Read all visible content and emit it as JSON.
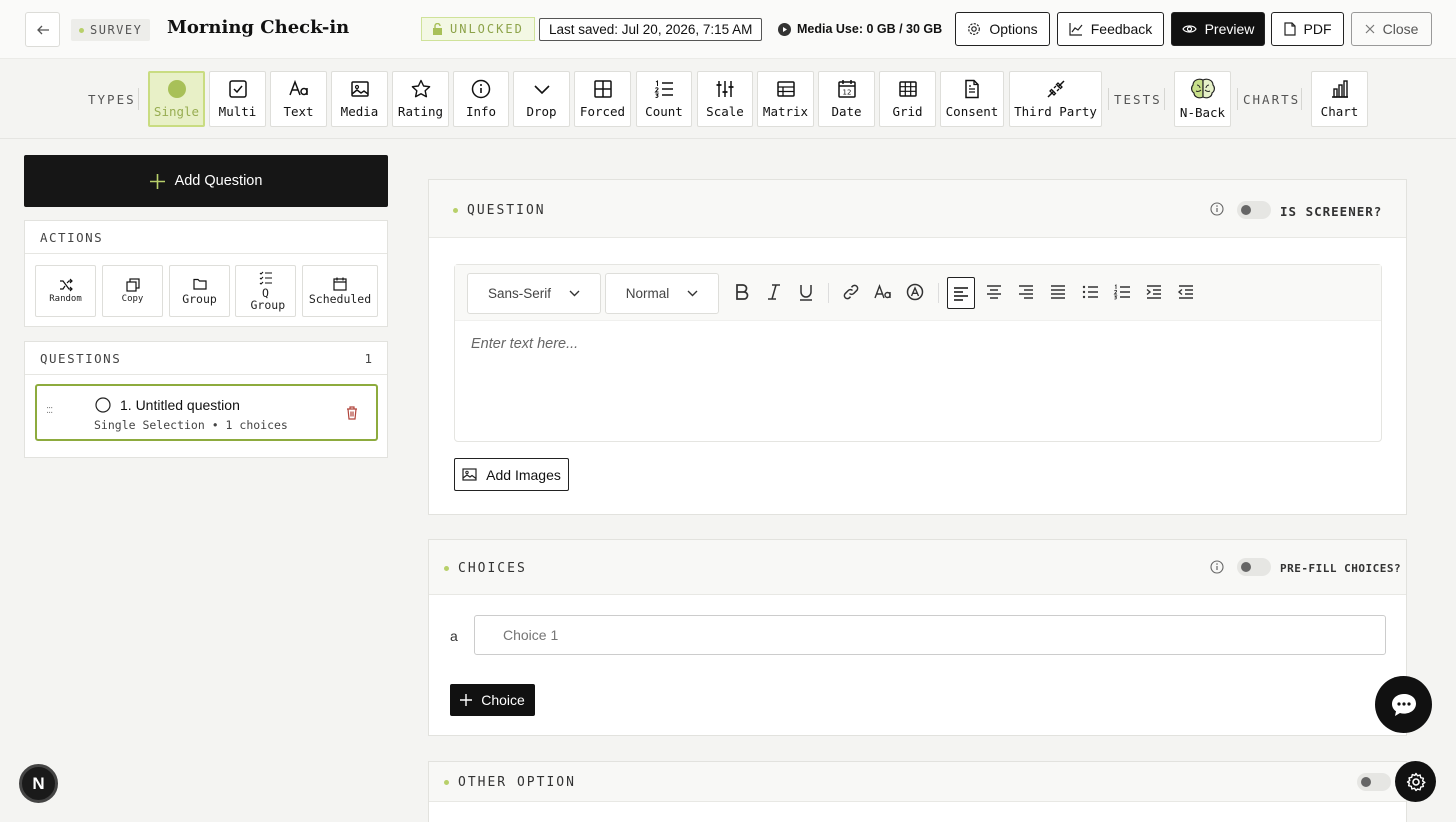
{
  "header": {
    "survey_tag": "SURVEY",
    "title": "Morning Check-in",
    "lock_status": "UNLOCKED",
    "last_saved": "Last saved: Jul 20, 2026, 7:15 AM",
    "media_use": "Media Use: 0 GB / 30 GB",
    "buttons": {
      "options": "Options",
      "feedback": "Feedback",
      "preview": "Preview",
      "pdf": "PDF",
      "close": "Close"
    }
  },
  "types_bar": {
    "types_label": "TYPES",
    "tests_label": "TESTS",
    "charts_label": "CHARTS",
    "types": [
      "Single",
      "Multi",
      "Text",
      "Media",
      "Rating",
      "Info",
      "Drop",
      "Forced",
      "Count",
      "Scale",
      "Matrix",
      "Date",
      "Grid",
      "Consent",
      "Third Party"
    ],
    "tests": [
      "N-Back"
    ],
    "charts": [
      "Chart"
    ],
    "active": "Single"
  },
  "sidebar": {
    "add_question": "Add Question",
    "actions_label": "ACTIONS",
    "actions": [
      "Random",
      "Copy",
      "Group",
      "Q Group",
      "Scheduled"
    ],
    "questions_label": "QUESTIONS",
    "questions_count": "1",
    "questions": [
      {
        "title": "1. Untitled question",
        "subtitle": "Single Selection • 1 choices"
      }
    ]
  },
  "question_card": {
    "label": "QUESTION",
    "screener_label": "IS SCREENER?",
    "font_family": "Sans-Serif",
    "font_size": "Normal",
    "editor_placeholder": "Enter text here...",
    "add_images": "Add Images"
  },
  "choices_card": {
    "label": "CHOICES",
    "prefill_label": "PRE-FILL CHOICES?",
    "choices": [
      {
        "letter": "a",
        "placeholder": "Choice 1"
      }
    ],
    "add_choice": "Choice"
  },
  "other_card": {
    "label": "OTHER OPTION"
  },
  "badge_letter": "N",
  "colors": {
    "accent": "#b8d06a",
    "active_bg": "#e8f0c7",
    "dark": "#111111",
    "delete": "#b0433a"
  }
}
